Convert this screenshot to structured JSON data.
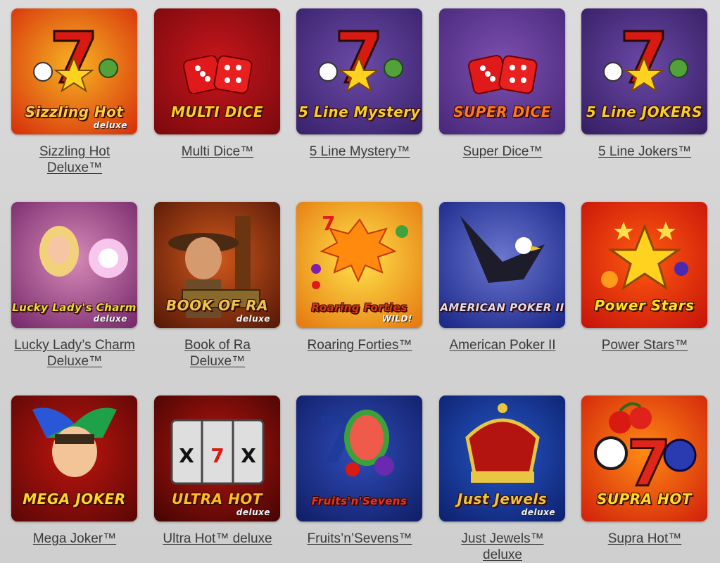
{
  "games": [
    {
      "title": "Sizzling Hot Deluxe™",
      "logo": "Sizzling Hot",
      "sub": "deluxe",
      "icon": "seven-fruits-icon",
      "bg": [
        "#f6b323",
        "#d8340c"
      ],
      "logo_color": "#ffcf3a"
    },
    {
      "title": "Multi Dice™",
      "logo": "MULTI DICE",
      "sub": "",
      "icon": "dice-icon",
      "bg": [
        "#c8161c",
        "#7d0a0e"
      ],
      "logo_color": "#ffcc22"
    },
    {
      "title": "5 Line Mystery™",
      "logo": "5 Line Mystery",
      "sub": "",
      "icon": "seven-star-icon",
      "bg": [
        "#6b4aa6",
        "#3b236e"
      ],
      "logo_color": "#f2d22a"
    },
    {
      "title": "Super Dice™",
      "logo": "SUPER DICE",
      "sub": "",
      "icon": "dice-icon",
      "bg": [
        "#7d4fb0",
        "#4a2a7c"
      ],
      "logo_color": "#ff7a1a"
    },
    {
      "title": "5 Line Jokers™",
      "logo": "5 Line JOKERS",
      "sub": "",
      "icon": "seven-star-icon",
      "bg": [
        "#6a48a6",
        "#382066"
      ],
      "logo_color": "#f2d22a"
    },
    {
      "title": "Lucky Lady’s Charm Deluxe™",
      "logo": "Lucky Lady's Charm",
      "sub": "deluxe",
      "icon": "lady-crystal-ball-icon",
      "bg": [
        "#d58ab8",
        "#7a2c6d"
      ],
      "logo_color": "#e6e03a"
    },
    {
      "title": "Book of Ra Deluxe™",
      "logo": "BOOK OF RA",
      "sub": "deluxe",
      "icon": "explorer-book-icon",
      "bg": [
        "#d0581c",
        "#5a1b08"
      ],
      "logo_color": "#e9c64a"
    },
    {
      "title": "Roaring Forties™",
      "logo": "Roaring Forties",
      "sub": "WILD!",
      "icon": "wild-fruits-icon",
      "bg": [
        "#ffe34a",
        "#e67c12"
      ],
      "logo_color": "#d63a12"
    },
    {
      "title": "American Poker II",
      "logo": "AMERICAN POKER II",
      "sub": "",
      "icon": "eagle-icon",
      "bg": [
        "#6a76cf",
        "#1d2a8a"
      ],
      "logo_color": "#d9dff7"
    },
    {
      "title": "Power Stars™",
      "logo": "Power Stars",
      "sub": "",
      "icon": "star-icon",
      "bg": [
        "#ff5a10",
        "#c9160a"
      ],
      "logo_color": "#ffe020"
    },
    {
      "title": "Mega Joker™",
      "logo": "MEGA JOKER",
      "sub": "",
      "icon": "jester-icon",
      "bg": [
        "#c0150f",
        "#5f0806"
      ],
      "logo_color": "#ffd52a"
    },
    {
      "title": "Ultra Hot™ deluxe",
      "logo": "ULTRA HOT",
      "sub": "deluxe",
      "icon": "slot-reels-icon",
      "bg": [
        "#b8150e",
        "#4a0604"
      ],
      "logo_color": "#ffbb22"
    },
    {
      "title": "Fruits’n’Sevens™",
      "logo": "Fruits'n'Sevens",
      "sub": "",
      "icon": "watermelon-icon",
      "bg": [
        "#2e4cb8",
        "#12206a"
      ],
      "logo_color": "#e3342a"
    },
    {
      "title": "Just Jewels™ deluxe",
      "logo": "Just Jewels",
      "sub": "deluxe",
      "icon": "crown-icon",
      "bg": [
        "#2757c6",
        "#0e2372"
      ],
      "logo_color": "#e8c641"
    },
    {
      "title": "Supra Hot™",
      "logo": "SUPRA HOT",
      "sub": "",
      "icon": "cherry-seven-icon",
      "bg": [
        "#ff8a14",
        "#d3260b"
      ],
      "logo_color": "#ffdd22"
    }
  ]
}
